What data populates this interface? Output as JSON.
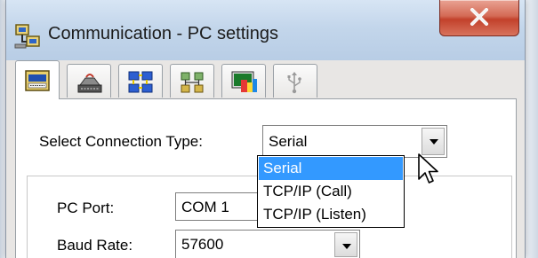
{
  "window": {
    "title": "Communication - PC settings",
    "icon": "network-computers-icon",
    "close_icon": "close-x-icon"
  },
  "tabs": [
    {
      "icon": "serial-settings-icon",
      "active": true
    },
    {
      "icon": "modem-icon",
      "active": false
    },
    {
      "icon": "network-blue-icon",
      "active": false
    },
    {
      "icon": "network-tree-icon",
      "active": false
    },
    {
      "icon": "display-colors-icon",
      "active": false
    },
    {
      "icon": "usb-icon",
      "active": false
    }
  ],
  "connection": {
    "label": "Select Connection Type:",
    "value": "Serial",
    "options": [
      "Serial",
      "TCP/IP (Call)",
      "TCP/IP (Listen)"
    ],
    "highlighted": "Serial"
  },
  "fields": {
    "pc_port_label": "PC Port:",
    "pc_port_value": "COM 1",
    "baud_rate_label": "Baud Rate:",
    "baud_rate_value": "57600"
  },
  "colors": {
    "highlight": "#3399ff",
    "close_button": "#c2412b",
    "titlebar": "#c3d6eb"
  }
}
